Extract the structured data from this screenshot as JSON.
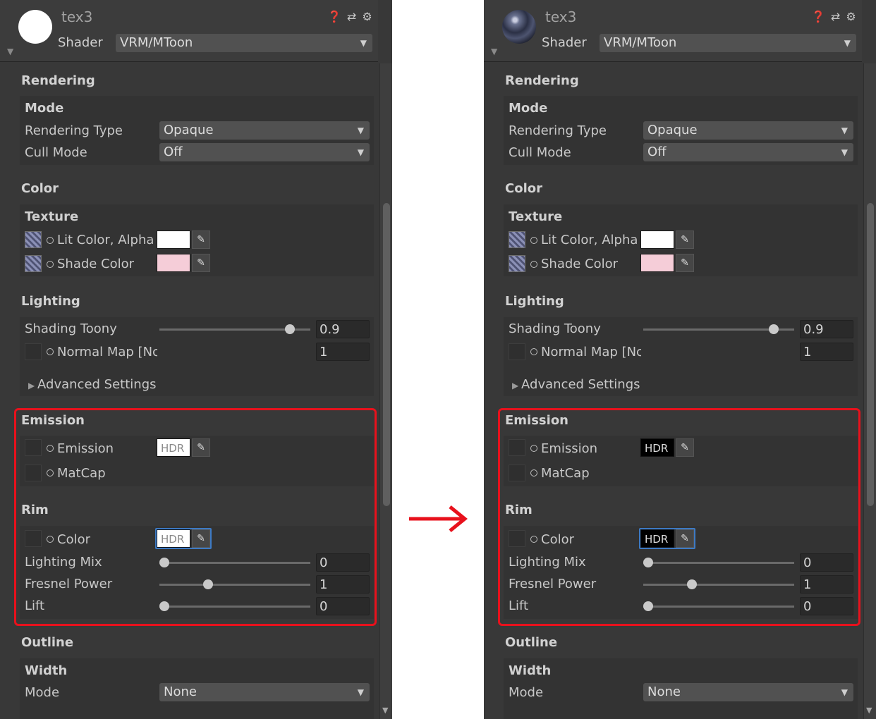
{
  "panels": {
    "before": {
      "title": "tex3",
      "shader_label": "Shader",
      "shader_value": "VRM/MToon",
      "rendering": {
        "header": "Rendering",
        "mode_header": "Mode",
        "rendering_type_label": "Rendering Type",
        "rendering_type_value": "Opaque",
        "cull_mode_label": "Cull Mode",
        "cull_mode_value": "Off"
      },
      "color": {
        "header": "Color",
        "texture_header": "Texture",
        "lit_label": "Lit Color, Alpha",
        "lit_color": "#ffffff",
        "shade_label": "Shade Color",
        "shade_color": "#f5cdd8"
      },
      "lighting": {
        "header": "Lighting",
        "shading_toony_label": "Shading Toony",
        "shading_toony_value": "0.9",
        "normal_map_label": "Normal Map [Nc",
        "normal_map_value": "1",
        "advanced": "Advanced Settings"
      },
      "emission": {
        "header": "Emission",
        "emission_label": "Emission",
        "emission_hdr": "HDR",
        "matcap_label": "MatCap"
      },
      "rim": {
        "header": "Rim",
        "color_label": "Color",
        "color_hdr": "HDR",
        "lighting_mix_label": "Lighting Mix",
        "lighting_mix_value": "0",
        "fresnel_label": "Fresnel Power",
        "fresnel_value": "1",
        "lift_label": "Lift",
        "lift_value": "0"
      },
      "outline": {
        "header": "Outline",
        "width_header": "Width",
        "mode_label": "Mode",
        "mode_value": "None"
      }
    },
    "after": {
      "title": "tex3",
      "shader_label": "Shader",
      "shader_value": "VRM/MToon",
      "rendering": {
        "header": "Rendering",
        "mode_header": "Mode",
        "rendering_type_label": "Rendering Type",
        "rendering_type_value": "Opaque",
        "cull_mode_label": "Cull Mode",
        "cull_mode_value": "Off"
      },
      "color": {
        "header": "Color",
        "texture_header": "Texture",
        "lit_label": "Lit Color, Alpha",
        "lit_color": "#ffffff",
        "shade_label": "Shade Color",
        "shade_color": "#f5cdd8"
      },
      "lighting": {
        "header": "Lighting",
        "shading_toony_label": "Shading Toony",
        "shading_toony_value": "0.9",
        "normal_map_label": "Normal Map [Nc",
        "normal_map_value": "1",
        "advanced": "Advanced Settings"
      },
      "emission": {
        "header": "Emission",
        "emission_label": "Emission",
        "emission_hdr": "HDR",
        "matcap_label": "MatCap"
      },
      "rim": {
        "header": "Rim",
        "color_label": "Color",
        "color_hdr": "HDR",
        "lighting_mix_label": "Lighting Mix",
        "lighting_mix_value": "0",
        "fresnel_label": "Fresnel Power",
        "fresnel_value": "1",
        "lift_label": "Lift",
        "lift_value": "0"
      },
      "outline": {
        "header": "Outline",
        "width_header": "Width",
        "mode_label": "Mode",
        "mode_value": "None"
      }
    }
  },
  "colors": {
    "highlight": "#e8111c",
    "focus": "#3d7ac4",
    "panel_bg": "#383838"
  },
  "icons": [
    "help-icon",
    "preset-icon",
    "settings-gear-icon",
    "eyedropper-icon",
    "dropdown-arrow-icon",
    "foldout-arrow-icon",
    "right-arrow-icon"
  ]
}
